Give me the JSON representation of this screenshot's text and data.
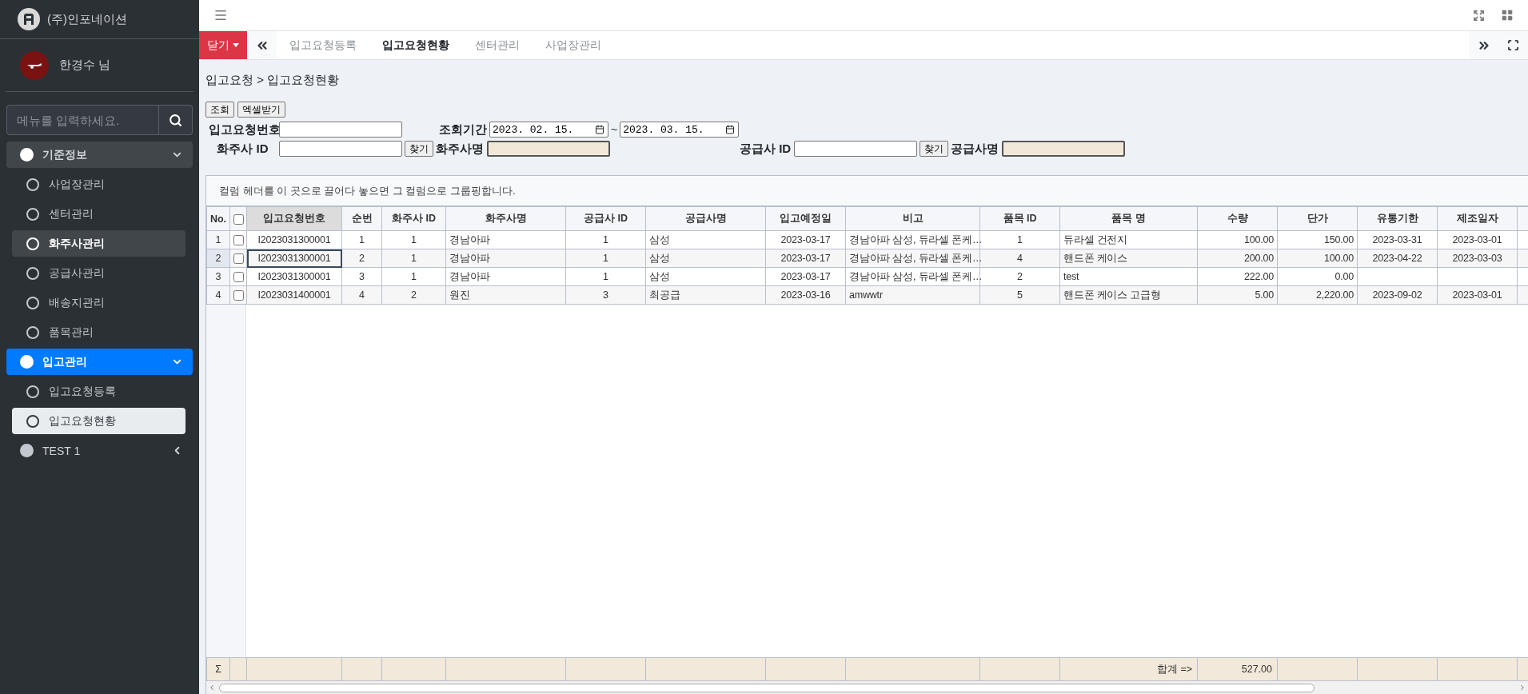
{
  "sidebar": {
    "brand": "(주)인포네이션",
    "user": "한경수 님",
    "search": {
      "placeholder": "메뉴를 입력하세요."
    },
    "menu": [
      {
        "label": "기준정보",
        "expanded": true,
        "selected": false,
        "children": [
          {
            "label": "사업장관리",
            "selected": false,
            "highlighted": false
          },
          {
            "label": "센터관리",
            "selected": false,
            "highlighted": false
          },
          {
            "label": "화주사관리",
            "selected": false,
            "highlighted": true
          },
          {
            "label": "공급사관리",
            "selected": false,
            "highlighted": false
          },
          {
            "label": "배송지관리",
            "selected": false,
            "highlighted": false
          },
          {
            "label": "품목관리",
            "selected": false,
            "highlighted": false
          }
        ]
      },
      {
        "label": "입고관리",
        "expanded": true,
        "selected": true,
        "children": [
          {
            "label": "입고요청등록",
            "selected": false,
            "highlighted": false
          },
          {
            "label": "입고요청현황",
            "selected": true,
            "highlighted": false
          }
        ]
      },
      {
        "label": "TEST 1",
        "expanded": false,
        "selected": false
      }
    ]
  },
  "tab_bar": {
    "close_button": "닫기",
    "tabs": [
      {
        "label": "입고요청등록",
        "selected": false
      },
      {
        "label": "입고요청현황",
        "selected": true
      },
      {
        "label": "센터관리",
        "selected": false
      },
      {
        "label": "사업장관리",
        "selected": false
      }
    ]
  },
  "breadcrumb": "입고요청 > 입고요청현황",
  "actions": [
    "조회",
    "엑셀받기"
  ],
  "filters": {
    "request_no": {
      "label": "입고요청번호"
    },
    "period": {
      "label": "조회기간",
      "from": "2023. 02. 15.",
      "separator": "~",
      "to": "2023. 03. 15."
    },
    "owner_id": {
      "label": "화주사 ID",
      "button": "찾기"
    },
    "owner_name": {
      "label": "화주사명"
    },
    "supplier_id": {
      "label": "공급사 ID",
      "button": "찾기"
    },
    "supplier_name": {
      "label": "공급사명"
    }
  },
  "grid": {
    "group_hint": "컬럼 헤더를 이 곳으로 끌어다 놓으면 그 컬럼으로 그룹핑합니다.",
    "no_label": "No.",
    "header_checked": false,
    "columns": [
      {
        "label": "입고요청번호",
        "kind": "id",
        "selected": true
      },
      {
        "label": "순번",
        "kind": "id",
        "selected": false
      },
      {
        "label": "화주사 ID",
        "kind": "id",
        "selected": false
      },
      {
        "label": "화주사명",
        "kind": "name",
        "selected": false
      },
      {
        "label": "공급사 ID",
        "kind": "id",
        "selected": false
      },
      {
        "label": "공급사명",
        "kind": "name",
        "selected": false
      },
      {
        "label": "입고예정일",
        "kind": "id",
        "selected": false
      },
      {
        "label": "비고",
        "kind": "name",
        "selected": false
      },
      {
        "label": "품목 ID",
        "kind": "id",
        "selected": false
      },
      {
        "label": "품목 명",
        "kind": "name",
        "selected": false,
        "footer": "합계 =>"
      },
      {
        "label": "수량",
        "kind": "amount",
        "selected": false,
        "footer": "527.00"
      },
      {
        "label": "단가",
        "kind": "amount",
        "selected": false
      },
      {
        "label": "유통기한",
        "kind": "id",
        "selected": false
      },
      {
        "label": "제조일자",
        "kind": "id",
        "selected": false
      }
    ],
    "rows": [
      {
        "no": "1",
        "checked": false,
        "focused": false,
        "cells": [
          "I2023031300001",
          "1",
          "1",
          "경남아파",
          "1",
          "삼성",
          "2023-03-17",
          "경남아파 삼성, 듀라셀 폰케…",
          "1",
          "듀라셀 건전지",
          "100.00",
          "150.00",
          "2023-03-31",
          "2023-03-01"
        ]
      },
      {
        "no": "2",
        "checked": false,
        "focused": true,
        "cells": [
          "I2023031300001",
          "2",
          "1",
          "경남아파",
          "1",
          "삼성",
          "2023-03-17",
          "경남아파 삼성, 듀라셀 폰케…",
          "4",
          "핸드폰 케이스",
          "200.00",
          "100.00",
          "2023-04-22",
          "2023-03-03"
        ]
      },
      {
        "no": "3",
        "checked": false,
        "focused": false,
        "cells": [
          "I2023031300001",
          "3",
          "1",
          "경남아파",
          "1",
          "삼성",
          "2023-03-17",
          "경남아파 삼성, 듀라셀 폰케…",
          "2",
          "test",
          "222.00",
          "0.00",
          null,
          null
        ]
      },
      {
        "no": "4",
        "checked": false,
        "focused": false,
        "cells": [
          "I2023031400001",
          "4",
          "2",
          "원진",
          "3",
          "최공급",
          "2023-03-16",
          "amwwtr",
          "5",
          "핸드폰 케이스 고급형",
          "5.00",
          "2,220.00",
          "2023-09-02",
          "2023-03-01"
        ]
      }
    ],
    "footer_symbol": "Σ"
  }
}
